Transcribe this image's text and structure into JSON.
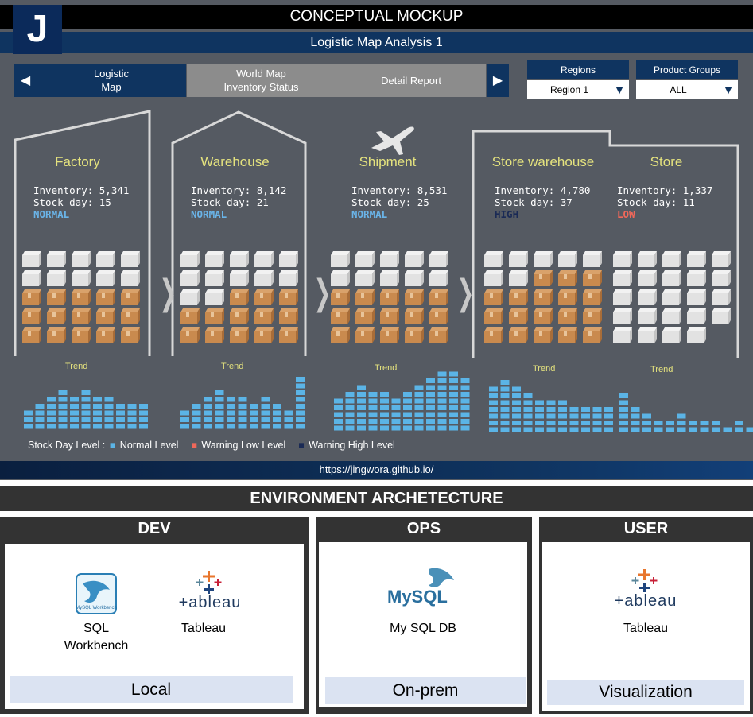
{
  "header": {
    "title": "CONCEPTUAL MOCKUP",
    "logo_letter": "J",
    "subtitle": "Logistic Map Analysis 1"
  },
  "nav": {
    "prev_icon": "triangle-left-icon",
    "next_icon": "triangle-right-icon",
    "tabs": [
      {
        "line1": "Logistic",
        "line2": "Map",
        "active": true
      },
      {
        "line1": "World Map",
        "line2": "Inventory Status",
        "active": false
      },
      {
        "line1": "Detail Report",
        "line2": "",
        "active": false
      }
    ]
  },
  "filters": {
    "regions": {
      "label": "Regions",
      "value": "Region 1"
    },
    "product_groups": {
      "label": "Product Groups",
      "value": "ALL"
    }
  },
  "stages": [
    {
      "name": "Factory",
      "inventory": "Inventory: 5,341",
      "stock_day": "Stock day: 15",
      "status": "NORMAL",
      "status_color": "#6ab4e8",
      "trend_label": "Trend",
      "boxes_brown": 15,
      "boxes_total": 25,
      "trend": [
        3,
        4,
        5,
        6,
        5,
        6,
        5,
        5,
        4,
        4,
        4
      ]
    },
    {
      "name": "Warehouse",
      "inventory": "Inventory: 8,142",
      "stock_day": "Stock day: 21",
      "status": "NORMAL",
      "status_color": "#6ab4e8",
      "trend_label": "Trend",
      "boxes_brown": 13,
      "boxes_total": 25,
      "trend": [
        3,
        4,
        5,
        6,
        5,
        5,
        4,
        5,
        4,
        3,
        8
      ]
    },
    {
      "name": "Shipment",
      "inventory": "Inventory: 8,531",
      "stock_day": "Stock day: 25",
      "status": "NORMAL",
      "status_color": "#6ab4e8",
      "trend_label": "Trend",
      "boxes_brown": 15,
      "boxes_total": 25,
      "trend": [
        5,
        6,
        7,
        6,
        6,
        5,
        6,
        7,
        8,
        9,
        9,
        8
      ]
    },
    {
      "name": "Store warehouse",
      "inventory": "Inventory: 4,780",
      "stock_day": "Stock day: 37",
      "status": "HIGH",
      "status_color": "#1a2a55",
      "trend_label": "Trend",
      "boxes_brown": 18,
      "boxes_total": 25,
      "trend": [
        7,
        8,
        7,
        6,
        5,
        5,
        5,
        4,
        4,
        4,
        4
      ]
    },
    {
      "name": "Store",
      "inventory": "Inventory: 1,337",
      "stock_day": "Stock day: 11",
      "status": "LOW",
      "status_color": "#f0685a",
      "trend_label": "Trend",
      "boxes_brown": 0,
      "boxes_total": 24,
      "trend": [
        6,
        4,
        3,
        2,
        2,
        3,
        2,
        2,
        2,
        1,
        2,
        1
      ]
    }
  ],
  "legend": {
    "prefix": "Stock Day Level :",
    "normal": "Normal Level",
    "warning_low": "Warning Low Level",
    "warning_high": "Warning High Level",
    "colors": {
      "normal": "#5bb4e6",
      "warning_low": "#f0685a",
      "warning_high": "#1a2a55"
    }
  },
  "footer_url": "https://jingwora.github.io/",
  "environment": {
    "title": "ENVIRONMENT ARCHETECTURE",
    "dev": {
      "title": "DEV",
      "tool1_line1": "SQL",
      "tool1_line2": "Workbench",
      "tool1_logo": "MySQL Workbench",
      "tool2": "Tableau",
      "tool2_logo": "+ableau",
      "foot": "Local"
    },
    "ops": {
      "title": "OPS",
      "tool": "My SQL DB",
      "logo": "MySQL",
      "foot": "On-prem"
    },
    "user": {
      "title": "USER",
      "tool": "Tableau",
      "logo": "+ableau",
      "foot": "Visualization"
    }
  }
}
